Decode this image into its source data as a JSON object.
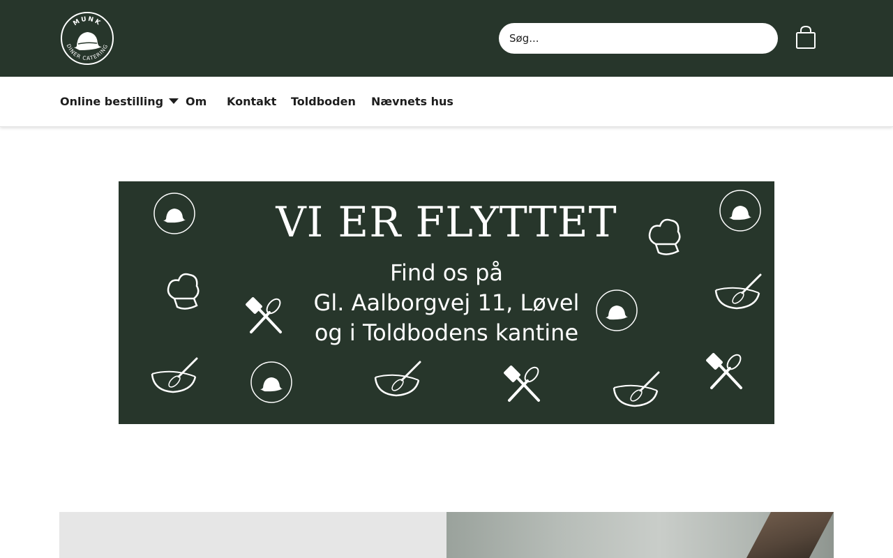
{
  "header": {
    "logo": {
      "top_text": "MUNK",
      "bottom_text": "DINER CATERING"
    },
    "search": {
      "placeholder": "Søg..."
    },
    "cart_icon": "shopping-bag-icon"
  },
  "nav": {
    "items": [
      {
        "label": "Online bestilling",
        "has_dropdown": true
      },
      {
        "label": "Om"
      },
      {
        "label": "Kontakt"
      },
      {
        "label": "Toldboden"
      },
      {
        "label": "Nævnets hus"
      }
    ]
  },
  "banner": {
    "title": "VI ER FLYTTET",
    "lines": [
      "Find os på",
      "Gl. Aalborgvej 11, Løvel",
      "og i Toldbodens kantine"
    ],
    "background_color": "#27362b",
    "logo_top_text": "MUNK",
    "logo_bottom_text": "DINER CATERING"
  },
  "colors": {
    "header_bg": "#27362b",
    "nav_text": "#1d1d1d"
  }
}
